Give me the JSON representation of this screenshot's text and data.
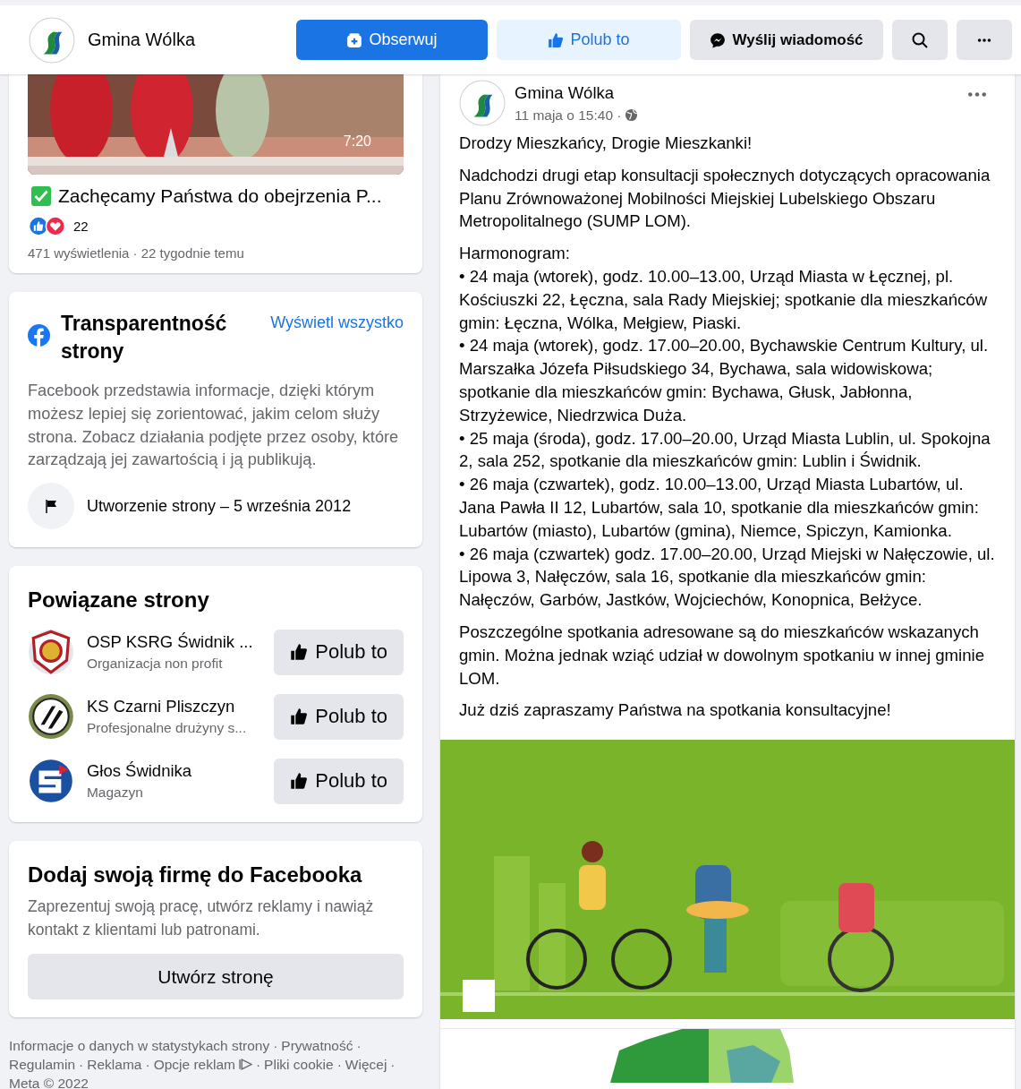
{
  "header": {
    "page_name": "Gmina Wólka",
    "buttons": [
      {
        "kind": "follow",
        "label": "Obserwuj"
      },
      {
        "kind": "like",
        "label": "Polub to"
      },
      {
        "kind": "message",
        "label": "Wyślij wiadomość"
      },
      {
        "kind": "search"
      },
      {
        "kind": "more"
      }
    ]
  },
  "video_card": {
    "duration": "7:20",
    "title": "Zachęcamy Państwa do obejrzenia P...",
    "reaction_count": "22",
    "meta": "471 wyświetlenia · 22 tygodnie temu"
  },
  "transparency": {
    "title": "Transparentność strony",
    "link": "Wyświetl wszystko",
    "description": "Facebook przedstawia informacje, dzięki którym możesz lepiej się zorientować, jakim celom służy strona. Zobacz działania podjęte przez osoby, które zarządzają jej zawartością i ją publikują.",
    "created": "Utworzenie strony – 5 września 2012"
  },
  "related": {
    "title": "Powiązane strony",
    "pages": [
      {
        "kind": "fire",
        "name": "OSP KSRG Świdnik ...",
        "category": "Organizacja non profit",
        "button": "Polub to"
      },
      {
        "kind": "club",
        "name": "KS Czarni Pliszczyn",
        "category": "Profesjonalne drużyny s...",
        "button": "Polub to"
      },
      {
        "kind": "magazine",
        "name": "Głos Świdnika",
        "category": "Magazyn",
        "button": "Polub to"
      }
    ]
  },
  "business": {
    "title": "Dodaj swoją firmę do Facebooka",
    "text": "Zaprezentuj swoją pracę, utwórz reklamy i nawiąż kontakt z klientami lub patronami.",
    "button": "Utwórz stronę"
  },
  "footer": {
    "separator": "·",
    "links": [
      "Informacje o danych w statystykach strony",
      "Prywatność",
      "Regulamin",
      "Reklama",
      "Opcje reklam",
      "Pliki cookie",
      "Więcej",
      "Meta © 2022"
    ]
  },
  "post": {
    "author": "Gmina Wólka",
    "time": "11 maja o 15:40 ·",
    "paragraphs": [
      [
        "Drodzy Mieszkańcy, Drogie Mieszkanki!"
      ],
      [
        "Nadchodzi drugi etap konsultacji społecznych dotyczących opracowania Planu Zrównoważonej Mobilności Miejskiej Lubelskiego Obszaru Metropolitalnego (SUMP LOM)."
      ],
      [
        "Harmonogram:",
        "• 24 maja (wtorek), godz. 10.00–13.00, Urząd Miasta w Łęcznej, pl. Kościuszki 22, Łęczna, sala Rady Miejskiej; spotkanie dla mieszkańców gmin: Łęczna, Wólka, Mełgiew, Piaski.",
        "• 24 maja (wtorek), godz. 17.00–20.00, Bychawskie Centrum Kultury, ul. Marszałka Józefa Piłsudskiego 34, Bychawa, sala widowiskowa; spotkanie dla mieszkańców gmin: Bychawa, Głusk, Jabłonna, Strzyżewice, Niedrzwica Duża.",
        "• 25 maja (środa), godz. 17.00–20.00, Urząd Miasta Lublin, ul. Spokojna 2, sala 252, spotkanie dla mieszkańców gmin: Lublin i Świdnik.",
        "• 26 maja (czwartek), godz. 10.00–13.00, Urząd Miasta Lubartów, ul. Jana Pawła II 12, Lubartów, sala 10, spotkanie dla mieszkańców gmin: Lubartów (miasto), Lubartów (gmina), Niemce, Spiczyn, Kamionka.",
        "• 26 maja (czwartek) godz. 17.00–20.00, Urząd Miejski w Nałęczowie, ul. Lipowa 3, Nałęczów, sala 16, spotkanie dla mieszkańców gmin: Nałęczów, Garbów, Jastków, Wojciechów, Konopnica, Bełżyce."
      ],
      [
        "Poszczególne spotkania adresowane są do mieszkańców wskazanych gmin. Można jednak wziąć udział w dowolnym spotkaniu w innej gminie LOM."
      ],
      [
        "Już dziś zapraszamy Państwa na spotkania konsultacyjne!"
      ]
    ]
  }
}
